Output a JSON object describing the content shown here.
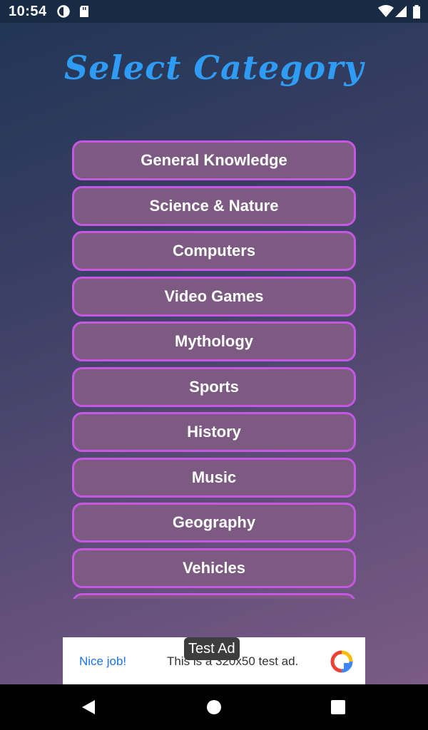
{
  "status_bar": {
    "time": "10:54"
  },
  "screen": {
    "title": "Select Category"
  },
  "categories": [
    {
      "label": "General Knowledge"
    },
    {
      "label": "Science & Nature"
    },
    {
      "label": "Computers"
    },
    {
      "label": "Video Games"
    },
    {
      "label": "Mythology"
    },
    {
      "label": "Sports"
    },
    {
      "label": "History"
    },
    {
      "label": "Music"
    },
    {
      "label": "Geography"
    },
    {
      "label": "Vehicles"
    },
    {
      "label": ""
    }
  ],
  "ad": {
    "label": "Test Ad",
    "cta": "Nice job!",
    "text": "This is a 320x50 test ad."
  },
  "colors": {
    "title": "#2e9bf5",
    "button_border": "#c557e3",
    "button_fill": "#7d5a82"
  },
  "icons": {
    "status": [
      "data-saver-icon",
      "sd-card-icon",
      "wifi-icon",
      "signal-icon",
      "battery-icon"
    ],
    "nav": [
      "back-icon",
      "home-icon",
      "recents-icon"
    ]
  }
}
